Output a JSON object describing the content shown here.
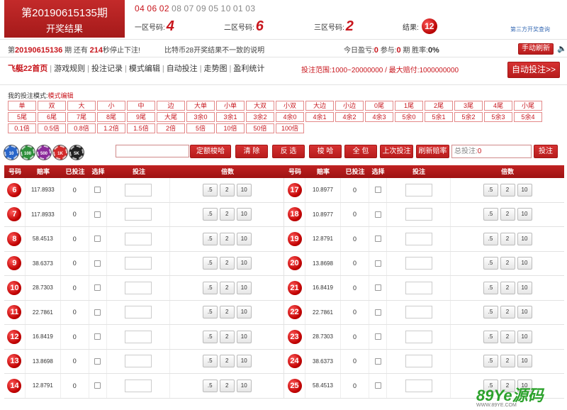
{
  "header": {
    "period_title": "第20190615135期",
    "result_label": "开奖结果",
    "draw_numbers": [
      "04",
      "06",
      "02",
      "08",
      "07",
      "09",
      "05",
      "10",
      "01",
      "03"
    ],
    "zone1_label": "一区号码:",
    "zone1_value": "4",
    "zone2_label": "二区号码:",
    "zone2_value": "6",
    "zone3_label": "三区号码:",
    "zone3_value": "2",
    "result_text": "结果:",
    "result_value": "12",
    "third_party_link": "第三方开奖查询"
  },
  "info": {
    "period_prefix": "第",
    "period": "20190615136",
    "period_suffix": "期 还有",
    "seconds": "214",
    "seconds_suffix": "秒停止下注!",
    "notice": "比特币28开奖结果不一致的说明",
    "profit_label": "今日盈亏:",
    "profit_value": "0",
    "participate_label": "参与:",
    "participate_value": "0",
    "period_unit": "期 胜率:",
    "winrate": "0%",
    "manual_refresh": "手动刷新",
    "speaker_icon": "speaker-icon"
  },
  "nav": {
    "items": [
      "飞艇22首页",
      "游戏规则",
      "投注记录",
      "模式编辑",
      "自动投注",
      "走势图",
      "盈利统计"
    ],
    "range_text": "投注范围:1000~20000000 / 最大赔付:1000000000",
    "auto_bet": "自动投注>>"
  },
  "mode": {
    "title": "我的投注模式:",
    "edit_link": "模式编辑",
    "rows": [
      [
        "单",
        "双",
        "大",
        "小",
        "中",
        "边",
        "大单",
        "小单",
        "大双",
        "小双",
        "大边",
        "小边",
        "0尾",
        "1尾",
        "2尾",
        "3尾",
        "4尾",
        "小尾"
      ],
      [
        "5尾",
        "6尾",
        "7尾",
        "8尾",
        "9尾",
        "大尾",
        "3余0",
        "3余1",
        "3余2",
        "4余0",
        "4余1",
        "4余2",
        "4余3",
        "5余0",
        "5余1",
        "5余2",
        "5余3",
        "5余4"
      ],
      [
        "0.1倍",
        "0.5倍",
        "0.8倍",
        "1.2倍",
        "1.5倍",
        "2倍",
        "5倍",
        "10倍",
        "50倍",
        "100倍"
      ]
    ]
  },
  "chips": [
    {
      "label": "10",
      "color": "#2a66c9"
    },
    {
      "label": "100",
      "color": "#2f8f3c"
    },
    {
      "label": "500",
      "color": "#8b2a9a"
    },
    {
      "label": "1K",
      "color": "#d22b2b"
    },
    {
      "label": "5K",
      "color": "#222222"
    }
  ],
  "actions": {
    "fixed_bet": "定额梭哈",
    "clear": "清 除",
    "invert": "反 选",
    "allin": "梭 哈",
    "cover": "全 包",
    "last_bet": "上次投注",
    "refresh_odds": "刷新赔率",
    "total_label": "总投注:",
    "total_value": "0",
    "submit": "投注"
  },
  "table": {
    "headers": [
      "号码",
      "赔率",
      "已投注",
      "选择",
      "投注",
      "倍数"
    ],
    "multiplier_buttons": [
      ".5",
      "2",
      "10"
    ],
    "left": [
      {
        "num": "6",
        "odds": "117.8933",
        "bet": "0"
      },
      {
        "num": "7",
        "odds": "117.8933",
        "bet": "0"
      },
      {
        "num": "8",
        "odds": "58.4513",
        "bet": "0"
      },
      {
        "num": "9",
        "odds": "38.6373",
        "bet": "0"
      },
      {
        "num": "10",
        "odds": "28.7303",
        "bet": "0"
      },
      {
        "num": "11",
        "odds": "22.7861",
        "bet": "0"
      },
      {
        "num": "12",
        "odds": "16.8419",
        "bet": "0"
      },
      {
        "num": "13",
        "odds": "13.8698",
        "bet": "0"
      },
      {
        "num": "14",
        "odds": "12.8791",
        "bet": "0"
      }
    ],
    "right": [
      {
        "num": "17",
        "odds": "10.8977",
        "bet": "0"
      },
      {
        "num": "18",
        "odds": "10.8977",
        "bet": "0"
      },
      {
        "num": "19",
        "odds": "12.8791",
        "bet": "0"
      },
      {
        "num": "20",
        "odds": "13.8698",
        "bet": "0"
      },
      {
        "num": "21",
        "odds": "16.8419",
        "bet": "0"
      },
      {
        "num": "22",
        "odds": "22.7861",
        "bet": "0"
      },
      {
        "num": "23",
        "odds": "28.7303",
        "bet": "0"
      },
      {
        "num": "24",
        "odds": "38.6373",
        "bet": "0"
      },
      {
        "num": "25",
        "odds": "58.4513",
        "bet": "0"
      }
    ]
  },
  "watermark": {
    "main": "89Ye源码",
    "sub": "WWW.89YE.COM"
  }
}
